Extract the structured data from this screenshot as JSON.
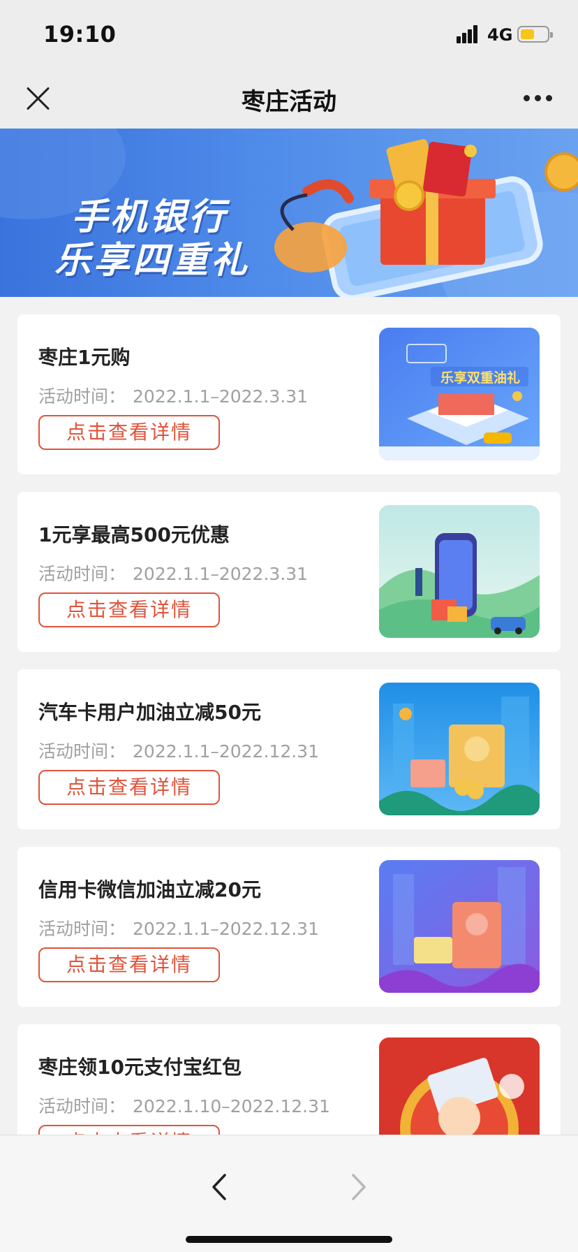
{
  "status_bar": {
    "time": "19:10",
    "network": "4G",
    "battery_color": "#f5c518"
  },
  "nav": {
    "title": "枣庄活动",
    "close_icon": "close-icon",
    "more_icon": "more-icon"
  },
  "banner": {
    "line1": "手机银行",
    "line2": "乐享四重礼"
  },
  "activities": [
    {
      "title": "枣庄1元购",
      "date_label": "活动时间：",
      "date_range": "2022.1.1–2022.3.31",
      "button": "点击查看详情",
      "thumb_text": "乐享双重油礼"
    },
    {
      "title": "1元享最高500元优惠",
      "date_label": "活动时间：",
      "date_range": "2022.1.1–2022.3.31",
      "button": "点击查看详情"
    },
    {
      "title": "汽车卡用户加油立减50元",
      "date_label": "活动时间：",
      "date_range": "2022.1.1–2022.12.31",
      "button": "点击查看详情"
    },
    {
      "title": "信用卡微信加油立减20元",
      "date_label": "活动时间：",
      "date_range": "2022.1.1–2022.12.31",
      "button": "点击查看详情"
    },
    {
      "title": "枣庄领10元支付宝红包",
      "date_label": "活动时间：",
      "date_range": "2022.1.10–2022.12.31",
      "button": "点击查看详情"
    }
  ],
  "bottom_bar": {
    "back_icon": "chevron-left-icon",
    "forward_icon": "chevron-right-icon"
  },
  "colors": {
    "accent": "#e0533a",
    "banner_blue": "#3a73dc"
  }
}
